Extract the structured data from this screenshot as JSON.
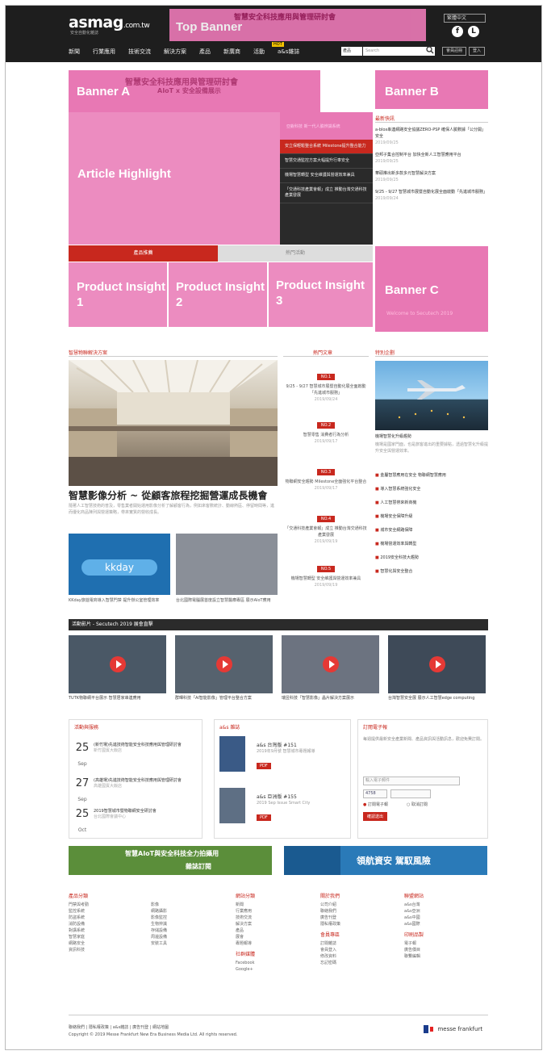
{
  "header": {
    "logo_text": "asmag",
    "logo_suffix": ".com.tw",
    "logo_sub": "安全自動化雜誌",
    "top_banner_label": "Top Banner",
    "top_banner_text": "智慧安全科技應用與管理研討會",
    "lang_select": "繁體中文",
    "facebook_icon": "f",
    "line_icon": "L",
    "nav": [
      "新聞",
      "行業應用",
      "技術交流",
      "解決方案",
      "產品",
      "新廣商",
      "活動",
      "a&s雜誌"
    ],
    "hot_badge": "HOT",
    "search_category": "產品",
    "search_placeholder": "Search",
    "register_label": "會員註冊",
    "login_label": "登入"
  },
  "banners": {
    "banner_a": "Banner A",
    "banner_a_text": "智慧安全科技應用與管理研討會",
    "banner_a_sub": "AIoT x 安全設備展示",
    "banner_b": "Banner B",
    "banner_c": "Banner C",
    "banner_c_text": "Welcome to Secutech 2019",
    "article_highlight": "Article Highlight",
    "product_insight_1": "Product Insight 1",
    "product_insight_2": "Product Insight 2",
    "product_insight_3": "Product Insight 3"
  },
  "highlight_list": {
    "title": "亞銳科技 新一代人臉辨識系統",
    "items": [
      "安立保輕鬆整合系統 Milestone提升整合能力",
      "智慧交通監控方案大幅提升行車安全",
      "機場智慧轉型 安全維護與營運效率兼具",
      "「交通科技產業會報」成立 推動台灣交通科技產業發展"
    ]
  },
  "tabs": {
    "products": "產品推薦",
    "hot": "熱門活動"
  },
  "latest_news": {
    "title": "最新快訊",
    "items": [
      {
        "text": "a-blox串連網路安全協議ZERO-PSP 確保人臉數據「公分開」安全",
        "date": "2019/09/25"
      },
      {
        "text": "亞邦子集合控制平台 加快全新人工智慧應用平台",
        "date": "2019/09/25"
      },
      {
        "text": "華碩推出新多款多元智慧解決方案",
        "date": "2019/09/25"
      },
      {
        "text": "9/25 - 9/27 智慧城市展暨自動化展全面啟動「先進城市服務」",
        "date": "2019/09/24"
      }
    ]
  },
  "solutions": {
    "title": "智慧物聯解決方案",
    "headline": "智慧影像分析 ~ 從顧客旅程挖掘營運成長機會",
    "summary": "隨著人工智慧技術的普及，零售業者開始運用影像分析了解顧客行為，例如來客數統計、動線熱區、停留時間等，進而優化商品陳列與營運策略，帶來實質的營收成長。",
    "sub_articles": [
      {
        "caption": "KKday旅遊電商導入智慧門禁 提升辦公室管理效率"
      },
      {
        "caption": "台北國際電腦展首度設立智慧醫療專區 展示AIoT應用"
      }
    ],
    "thumb_brand": "kkday"
  },
  "hot_articles": {
    "title": "熱門文章",
    "items": [
      {
        "rank": "NO.1",
        "text": "9/25 - 9/27 智慧城市展暨自動化展全面啟動「先進城市服務」",
        "date": "2019/09/24"
      },
      {
        "rank": "NO.2",
        "text": "智慧零售 消費者行為分析",
        "date": "2019/09/17"
      },
      {
        "rank": "NO.3",
        "text": "物聯網安全趨勢 Milestone全面強化平台整合",
        "date": "2019/09/17"
      },
      {
        "rank": "NO.4",
        "text": "「交通科技產業會報」成立 推動台灣交通科技產業發展",
        "date": "2019/09/19"
      },
      {
        "rank": "NO.5",
        "text": "機場智慧轉型 安全維護與營運效率兼具",
        "date": "2019/09/19"
      }
    ]
  },
  "special_topic": {
    "title": "特別企劃",
    "lead": "機場智慧化升級趨勢",
    "lead_summary": "機場是國家門面，也是旅客進出的重要據點，透過智慧化升級提升安全與營運效率。",
    "items": [
      "金屬智慧應用在安全 物聯網智慧應用",
      "導入智慧系統強化安全",
      "人工智慧帶來新商機",
      "機場安全保障升級",
      "城市安全網路保障",
      "機場營運效率與轉型",
      "2019安全科技大趨勢",
      "智慧化與安全整合"
    ]
  },
  "videos": {
    "title": "活動影片 - Secutech 2019 展會直擊",
    "items": [
      {
        "caption": "TUTK物聯網平台展示 智慧居家串連應用"
      },
      {
        "caption": "群暉科技「AI智能影像」管理平台整合方案"
      },
      {
        "caption": "瑞昱科技「智慧影像」晶片解決方案展示"
      },
      {
        "caption": "台灣智慧安全展 展示人工智慧edge computing"
      }
    ]
  },
  "events": {
    "title": "活動與服務",
    "items": [
      {
        "day": "25",
        "month": "Sep",
        "text": "(新竹場)先進技術智能安全科技應用與管理研討會",
        "loc": "新竹國賓大飯店"
      },
      {
        "day": "27",
        "month": "Sep",
        "text": "(高雄場)先進技術智能安全科技應用與管理研討會",
        "loc": "高雄國賓大飯店"
      },
      {
        "day": "25",
        "month": "Oct",
        "text": "2019智慧城市暨物聯網安全研討會",
        "loc": "台北國際會議中心"
      }
    ]
  },
  "magazine": {
    "title": "a&s 雜誌",
    "items": [
      {
        "name": "a&s 台灣版 #151",
        "desc": "2019年9月號 智慧城市專題報導",
        "pdf": "PDF"
      },
      {
        "name": "a&s 亞洲版 #155",
        "desc": "2019 Sep Issue Smart City",
        "pdf": "PDF"
      }
    ]
  },
  "subscribe": {
    "title": "訂閱電子報",
    "desc": "每週提供最新安全產業新聞、產品資訊與活動訊息，歡迎免費訂閱。",
    "email_placeholder": "輸入電子郵件",
    "captcha": "4758",
    "opt_subscribe": "訂閱電子報",
    "opt_unsubscribe": "取消訂閱",
    "button": "確認送出"
  },
  "ads": {
    "left_text": "智慧AIoT與安全科技全力拍攝用",
    "left_cta": "雜誌訂閱",
    "right_text": "領航資安 駕馭風險"
  },
  "footer": {
    "cols": [
      {
        "title": "產品分類",
        "items": [
          "門禁與考勤",
          "監控系統",
          "防盜系統",
          "消防設備",
          "對講系統",
          "智慧家庭",
          "網路安全",
          "資訊科技"
        ]
      },
      {
        "title": "",
        "items": [
          "影像",
          "網路攝影",
          "影像監控",
          "生物辨識",
          "存儲設備",
          "周邊設備",
          "安裝工具"
        ]
      },
      {
        "title": "網站分類",
        "items": [
          "新聞",
          "行業應用",
          "技術交流",
          "解決方案",
          "產品",
          "展會",
          "專題報導"
        ]
      },
      {
        "title": "關於我們",
        "items": [
          "公司介紹",
          "聯絡我們",
          "廣告刊登",
          "隱私權政策"
        ]
      },
      {
        "title": "聯盟網站",
        "items": [
          "a&s台灣",
          "a&s亞洲",
          "a&s中國",
          "a&s國際"
        ]
      }
    ],
    "social_title": "社群媒體",
    "social_items": [
      "Facebook",
      "Google+"
    ],
    "member_title": "會員專區",
    "member_items": [
      "訂閱雜誌",
      "會員登入",
      "修改資料",
      "忘記密碼"
    ],
    "mag_title": "印刷品製",
    "mag_items": [
      "電子報",
      "廣告價目",
      "聯繫編輯"
    ],
    "links": "聯絡我們 | 隱私權政策 | a&s雜誌 | 廣告刊登 | 網站地圖",
    "copyright": "Copyright © 2019 Messe Frankfurt New Era Business Media Ltd. All rights reserved.",
    "brand": "messe frankfurt"
  }
}
